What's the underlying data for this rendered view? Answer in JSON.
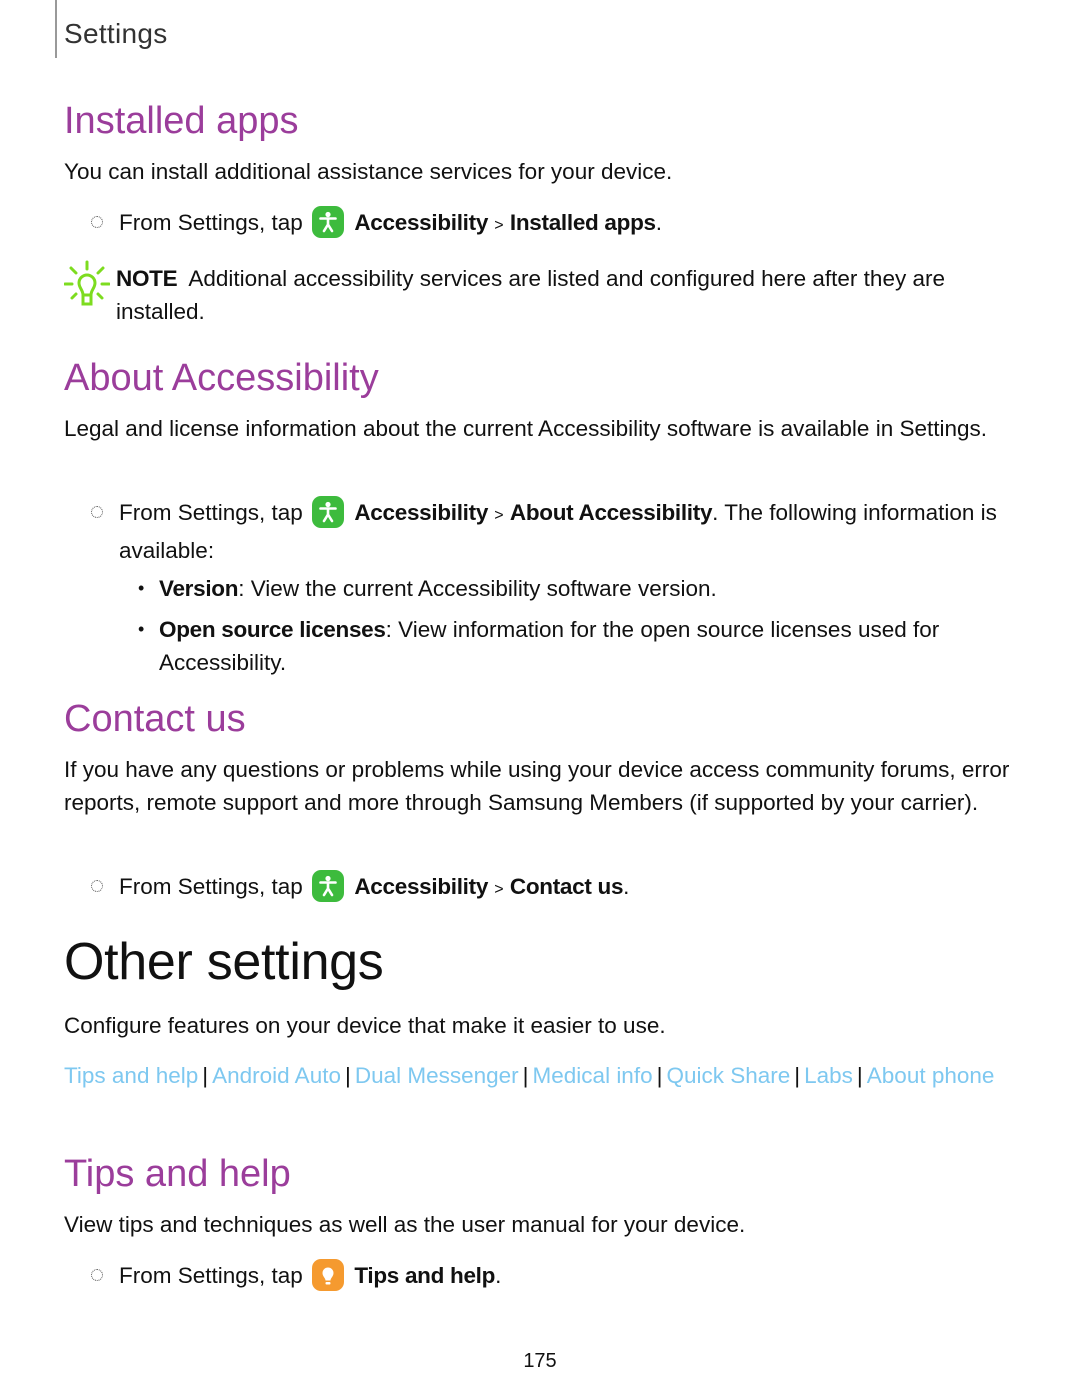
{
  "header": {
    "title": "Settings"
  },
  "sections": {
    "installed_apps": {
      "heading": "Installed apps",
      "intro": "You can install additional assistance services for your device.",
      "step": {
        "prefix": "From Settings, tap",
        "icon": "accessibility-icon",
        "path1": "Accessibility",
        "sep": ">",
        "path2": "Installed apps",
        "suffix": "."
      },
      "note": {
        "label": "NOTE",
        "text": "Additional accessibility services are listed and configured here after they are installed.",
        "icon": "lightbulb-icon"
      }
    },
    "about_accessibility": {
      "heading": "About Accessibility",
      "intro": "Legal and license information about the current Accessibility software is available in Settings.",
      "step": {
        "prefix": "From Settings, tap",
        "icon": "accessibility-icon",
        "path1": "Accessibility",
        "sep": ">",
        "path2": "About Accessibility",
        "suffix": ". The following information is available:"
      },
      "items": [
        {
          "term": "Version",
          "desc": ": View the current Accessibility software version."
        },
        {
          "term": "Open source licenses",
          "desc": ": View information for the open source licenses used for Accessibility."
        }
      ]
    },
    "contact_us": {
      "heading": "Contact us",
      "intro": "If you have any questions or problems while using your device access community forums, error reports, remote support and more through Samsung Members (if supported by your carrier).",
      "step": {
        "prefix": "From Settings, tap",
        "icon": "accessibility-icon",
        "path1": "Accessibility",
        "sep": ">",
        "path2": "Contact us",
        "suffix": "."
      }
    },
    "other_settings": {
      "heading": "Other settings",
      "intro": "Configure features on your device that make it easier to use.",
      "links": [
        "Tips and help",
        "Android Auto",
        "Dual Messenger",
        "Medical info",
        "Quick Share",
        "Labs",
        "About phone"
      ],
      "link_separator": "|"
    },
    "tips_and_help": {
      "heading": "Tips and help",
      "intro": "View tips and techniques as well as the user manual for your device.",
      "step": {
        "prefix": "From Settings, tap",
        "icon": "tips-icon",
        "path1": "Tips and help",
        "suffix": "."
      }
    }
  },
  "colors": {
    "heading": "#9b3d9b",
    "link": "#7ec8f0",
    "accessibility_icon": "#3dbb3d",
    "tips_icon": "#f59a2f",
    "note_icon": "#7ddc1f"
  },
  "footer": {
    "page_number": "175"
  }
}
